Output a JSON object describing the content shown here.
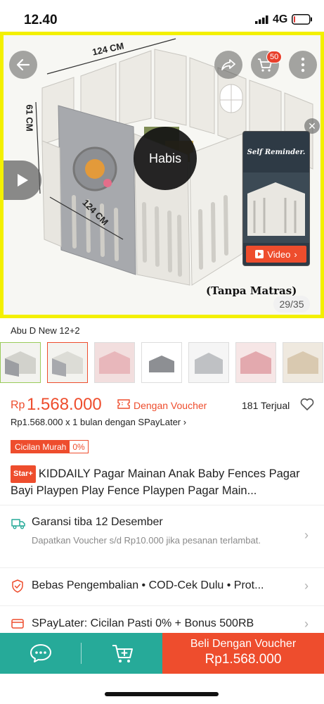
{
  "status_bar": {
    "time": "12.40",
    "network": "4G"
  },
  "hero": {
    "dim_top": "124 CM",
    "dim_left": "61 CM",
    "dim_bottom": "124 CM",
    "sold_out_label": "Habis",
    "caption": "(Tanpa Matras)",
    "image_counter": "29/35",
    "cart_badge": "50",
    "video_card": {
      "title": "Self Reminder.",
      "button_label": "Video"
    }
  },
  "variant": {
    "name": "Abu D New 12+2"
  },
  "price": {
    "currency": "Rp",
    "amount": "1.568.000",
    "voucher_label": "Dengan Voucher",
    "sold": "181 Terjual",
    "installment": "Rp1.568.000 x 1 bulan dengan SPayLater",
    "tag_label": "Cicilan Murah",
    "tag_value": "0%"
  },
  "product": {
    "badge": "Star+",
    "title": "KIDDAILY Pagar Mainan Anak Baby Fences Pagar Bayi Playpen Play Fence Playpen Pagar Main..."
  },
  "shipping": {
    "title": "Garansi tiba 12 Desember",
    "subtitle": "Dapatkan Voucher s/d Rp10.000 jika pesanan terlambat."
  },
  "guarantee": {
    "text": "Bebas Pengembalian  •  COD-Cek Dulu  •  Prot..."
  },
  "paylater": {
    "text": "SPayLater: Cicilan Pasti 0% + Bonus 500RB"
  },
  "bottom_bar": {
    "buy_label": "Beli Dengan Voucher",
    "buy_price": "Rp1.568.000"
  },
  "colors": {
    "accent": "#ee4d2d",
    "teal": "#26aa99",
    "hero_border": "#f3f000"
  }
}
